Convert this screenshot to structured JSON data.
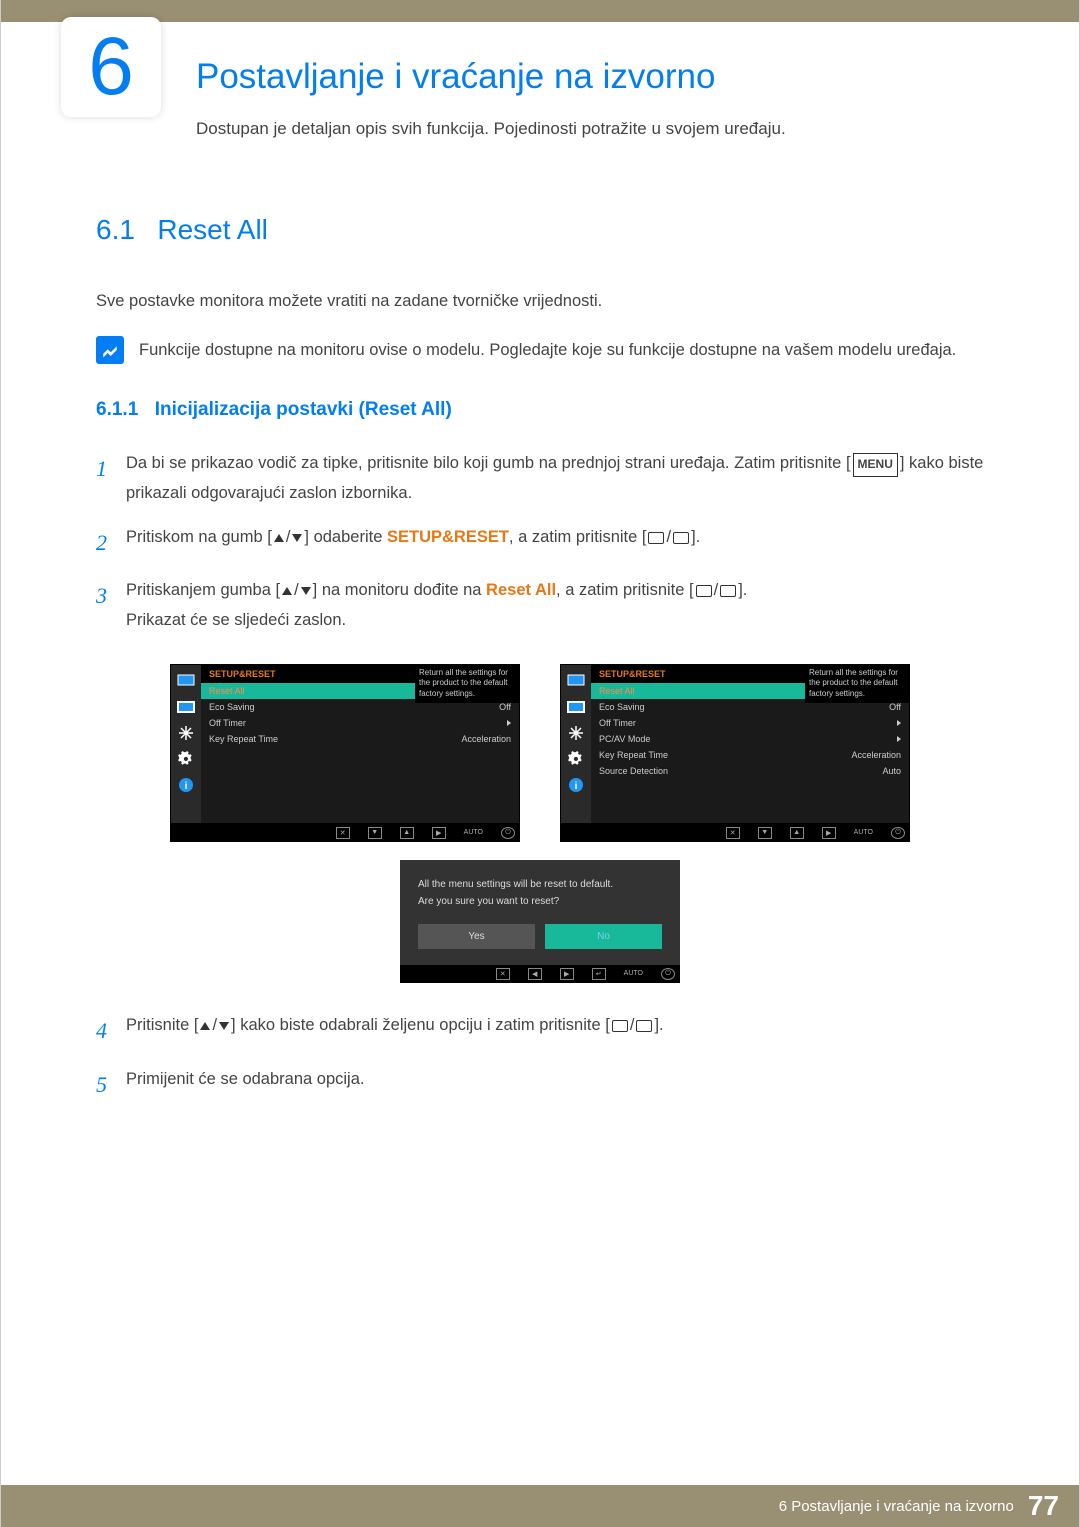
{
  "chapter": {
    "num": "6",
    "title": "Postavljanje i vraćanje na izvorno",
    "sub": "Dostupan je detaljan opis svih funkcija. Pojedinosti potražite u svojem uređaju."
  },
  "section": {
    "num": "6.1",
    "title": "Reset All",
    "desc": "Sve postavke monitora možete vratiti na zadane tvorničke vrijednosti.",
    "note": "Funkcije dostupne na monitoru ovise o modelu. Pogledajte koje su funkcije dostupne na vašem modelu uređaja."
  },
  "subsec": {
    "num": "6.1.1",
    "title": "Inicijalizacija postavki (Reset All)"
  },
  "steps": {
    "s1a": "Da bi se prikazao vodič za tipke, pritisnite bilo koji gumb na prednjoj strani uređaja. Zatim pritisnite ",
    "s1b": " kako biste prikazali odgovarajući zaslon izbornika.",
    "menu": "MENU",
    "s2a": "Pritiskom na gumb ",
    "s2b": " odaberite ",
    "s2c": "SETUP&RESET",
    "s2d": ", a zatim pritisnite ",
    "s3a": "Pritiskanjem gumba ",
    "s3b": " na monitoru dođite na ",
    "s3c": "Reset All",
    "s3d": ", a zatim pritisnite ",
    "s3e": "Prikazat će se sljedeći zaslon.",
    "s4a": "Pritisnite ",
    "s4b": " kako biste odabrali željenu opciju i zatim pritisnite ",
    "s5": "Primijenit će se odabrana opcija."
  },
  "osd": {
    "header": "SETUP&RESET",
    "tip": "Return all the settings for the product to the default factory settings.",
    "left": [
      {
        "l": "Reset All",
        "v": "",
        "sel": true
      },
      {
        "l": "Eco Saving",
        "v": "Off"
      },
      {
        "l": "Off Timer",
        "v": "▸"
      },
      {
        "l": "Key Repeat Time",
        "v": "Acceleration"
      }
    ],
    "right": [
      {
        "l": "Reset All",
        "v": "",
        "sel": true
      },
      {
        "l": "Eco Saving",
        "v": "Off"
      },
      {
        "l": "Off Timer",
        "v": "▸"
      },
      {
        "l": "PC/AV Mode",
        "v": "▸"
      },
      {
        "l": "Key Repeat Time",
        "v": "Acceleration"
      },
      {
        "l": "Source Detection",
        "v": "Auto"
      }
    ],
    "auto": "AUTO"
  },
  "modal": {
    "line1": "All the menu settings will be reset to default.",
    "line2": "Are you sure you want to reset?",
    "yes": "Yes",
    "no": "No"
  },
  "footer": {
    "text": "6 Postavljanje i vraćanje na izvorno",
    "num": "77"
  }
}
